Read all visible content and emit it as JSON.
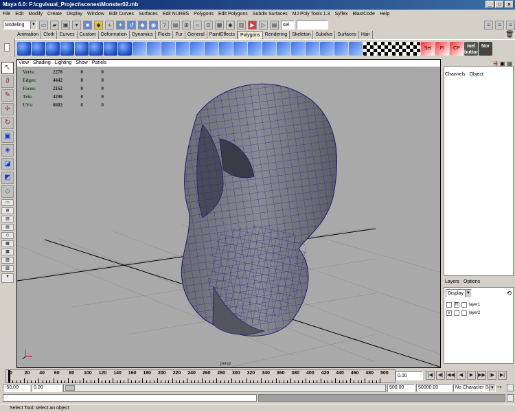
{
  "window": {
    "title": "Maya 6.0: F:\\cgvisual_Project\\scenes\\Monster02.mb",
    "min": "_",
    "max": "□",
    "close": "×"
  },
  "menubar": [
    "File",
    "Edit",
    "Modify",
    "Create",
    "Display",
    "Window",
    "Edit Curves",
    "Surfaces",
    "Edit NURBS",
    "Polygons",
    "Edit Polygons",
    "Subdiv Surfaces",
    "MJ Poly Tools 1.3",
    "Syflex",
    "BlastCode",
    "Help"
  ],
  "statusline": {
    "mode": "Modeling",
    "sel_label": "sel"
  },
  "shelf_tabs": [
    "Animation",
    "Cloth",
    "Curves",
    "Custom",
    "Deformation",
    "Dynamics",
    "Fluids",
    "Fur",
    "General",
    "PaintEffects",
    "Polygons",
    "Rendering",
    "Skeleton",
    "Subdivs",
    "Surfaces",
    "Hair"
  ],
  "shelf_active": "Polygons",
  "shelf_icons_text": {
    "set": "Set",
    "fi": "FI",
    "cp": "CP",
    "mel": "mel button",
    "nor": "Nor"
  },
  "viewport": {
    "menu": [
      "View",
      "Shading",
      "Lighting",
      "Show",
      "Panels"
    ],
    "hud": [
      {
        "label": "Verts:",
        "v1": "2278",
        "v2": "0",
        "v3": "0"
      },
      {
        "label": "Edges:",
        "v1": "4442",
        "v2": "0",
        "v3": "0"
      },
      {
        "label": "Faces:",
        "v1": "2162",
        "v2": "0",
        "v3": "0"
      },
      {
        "label": "Tris:",
        "v1": "4298",
        "v2": "0",
        "v3": "0"
      },
      {
        "label": "UVs:",
        "v1": "6602",
        "v2": "0",
        "v3": "0"
      }
    ],
    "camera": "persp"
  },
  "channelbox": {
    "tabs": [
      "Channels",
      "Object"
    ]
  },
  "layers": {
    "menu": [
      "Layers",
      "Options"
    ],
    "display": "Display",
    "rows": [
      {
        "vis": "",
        "r": "R",
        "name": "layer1"
      },
      {
        "vis": "V",
        "r": "",
        "name": "layer2"
      }
    ]
  },
  "timeslider": {
    "ticks": [
      "0",
      "20",
      "40",
      "60",
      "80",
      "100",
      "120",
      "140",
      "160",
      "180",
      "200",
      "220",
      "240",
      "260",
      "280",
      "300",
      "320",
      "340",
      "360",
      "380",
      "400",
      "420",
      "440",
      "460",
      "480",
      "500"
    ],
    "current_frame": "0.00"
  },
  "range": {
    "start": "-50.00",
    "current_start": "0.00",
    "current_end": "500.00",
    "end": "50000.00",
    "character_set": "No Character Set"
  },
  "helpline": "Select Tool: select an object",
  "colors": {
    "wire": "#2020a0",
    "mesh": "#7d7d85",
    "viewport_bg": "#a9a9a9"
  }
}
